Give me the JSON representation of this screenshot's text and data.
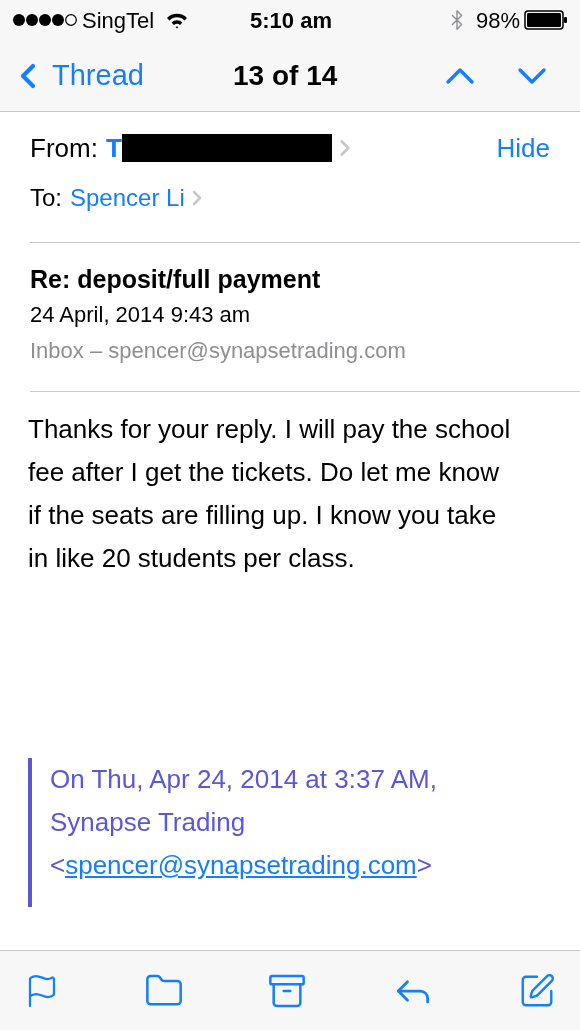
{
  "status_bar": {
    "carrier": "SingTel",
    "time": "5:10 am",
    "battery": "98%"
  },
  "nav": {
    "back": "Thread",
    "title": "13 of 14"
  },
  "header": {
    "from_label": "From:",
    "from_name": "T",
    "hide": "Hide",
    "to_label": "To:",
    "to_name": "Spencer Li"
  },
  "message": {
    "subject": "Re: deposit/full payment",
    "date": "24 April, 2014 9:43 am",
    "mailbox": "Inbox – spencer@synapsetrading.com",
    "body": "Thanks for your reply. I will pay the school fee after I get the tickets. Do let me know if the seats are filling up. I know you take in like 20 students per class.",
    "quote": {
      "intro": "On Thu, Apr 24, 2014 at 3:37 AM, Synapse Trading",
      "open": "<",
      "link": "spencer@synapsetrading.com",
      "close": ">"
    }
  }
}
